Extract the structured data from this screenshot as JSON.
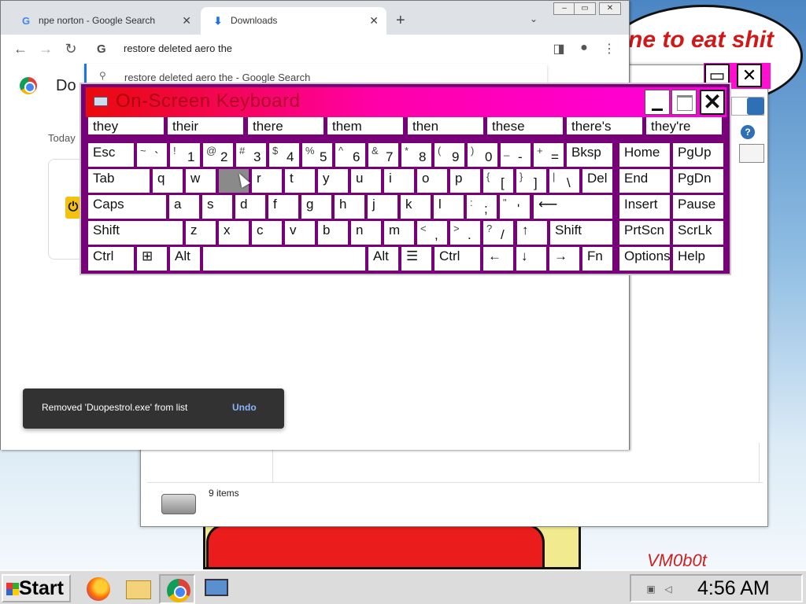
{
  "desktop": {
    "bubble_text": "ne to eat shit",
    "watermark": "VM0b0t"
  },
  "explorer": {
    "status_text": "9 items"
  },
  "chrome": {
    "tabs": [
      {
        "label": "npe norton - Google Search",
        "icon": "G"
      },
      {
        "label": "Downloads",
        "icon": "⬇"
      }
    ],
    "omnibox": {
      "value": "restore deleted aero the",
      "suggestion": "restore deleted aero the - Google Search"
    },
    "page_title": "Do",
    "today_label": "Today",
    "snackbar": {
      "text": "Removed 'Duopestrol.exe' from list",
      "action": "Undo"
    }
  },
  "osk": {
    "title": "On-Screen Keyboard",
    "predictions": [
      "they",
      "their",
      "there",
      "them",
      "then",
      "these",
      "there's",
      "they're"
    ],
    "rows": {
      "r1": [
        {
          "s": "",
          "m": "Esc"
        },
        {
          "s": "~",
          "m": "`"
        },
        {
          "s": "!",
          "m": "1"
        },
        {
          "s": "@",
          "m": "2"
        },
        {
          "s": "#",
          "m": "3"
        },
        {
          "s": "$",
          "m": "4"
        },
        {
          "s": "%",
          "m": "5"
        },
        {
          "s": "^",
          "m": "6"
        },
        {
          "s": "&",
          "m": "7"
        },
        {
          "s": "*",
          "m": "8"
        },
        {
          "s": "(",
          "m": "9"
        },
        {
          "s": ")",
          "m": "0"
        },
        {
          "s": "_",
          "m": "-"
        },
        {
          "s": "+",
          "m": "="
        },
        {
          "s": "",
          "m": "Bksp"
        },
        {
          "s": "",
          "m": "Home"
        },
        {
          "s": "",
          "m": "PgUp"
        }
      ],
      "r2": [
        {
          "s": "",
          "m": "Tab"
        },
        {
          "s": "",
          "m": "q"
        },
        {
          "s": "",
          "m": "w"
        },
        {
          "s": "",
          "m": ""
        },
        {
          "s": "",
          "m": "r"
        },
        {
          "s": "",
          "m": "t"
        },
        {
          "s": "",
          "m": "y"
        },
        {
          "s": "",
          "m": "u"
        },
        {
          "s": "",
          "m": "i"
        },
        {
          "s": "",
          "m": "o"
        },
        {
          "s": "",
          "m": "p"
        },
        {
          "s": "{",
          "m": "["
        },
        {
          "s": "}",
          "m": "]"
        },
        {
          "s": "|",
          "m": "\\"
        },
        {
          "s": "",
          "m": "Del"
        },
        {
          "s": "",
          "m": "End"
        },
        {
          "s": "",
          "m": "PgDn"
        }
      ],
      "r3": [
        {
          "s": "",
          "m": "Caps"
        },
        {
          "s": "",
          "m": "a"
        },
        {
          "s": "",
          "m": "s"
        },
        {
          "s": "",
          "m": "d"
        },
        {
          "s": "",
          "m": "f"
        },
        {
          "s": "",
          "m": "g"
        },
        {
          "s": "",
          "m": "h"
        },
        {
          "s": "",
          "m": "j"
        },
        {
          "s": "",
          "m": "k"
        },
        {
          "s": "",
          "m": "l"
        },
        {
          "s": ":",
          "m": ";"
        },
        {
          "s": "\"",
          "m": "'"
        },
        {
          "s": "",
          "m": "⟵"
        },
        {
          "s": "",
          "m": "Insert"
        },
        {
          "s": "",
          "m": "Pause"
        }
      ],
      "r4": [
        {
          "s": "",
          "m": "Shift"
        },
        {
          "s": "",
          "m": "z"
        },
        {
          "s": "",
          "m": "x"
        },
        {
          "s": "",
          "m": "c"
        },
        {
          "s": "",
          "m": "v"
        },
        {
          "s": "",
          "m": "b"
        },
        {
          "s": "",
          "m": "n"
        },
        {
          "s": "",
          "m": "m"
        },
        {
          "s": "<",
          "m": ","
        },
        {
          "s": ">",
          "m": "."
        },
        {
          "s": "?",
          "m": "/"
        },
        {
          "s": "",
          "m": "↑"
        },
        {
          "s": "",
          "m": "Shift"
        },
        {
          "s": "",
          "m": "PrtScn"
        },
        {
          "s": "",
          "m": "ScrLk"
        }
      ],
      "r5": [
        {
          "s": "",
          "m": "Ctrl"
        },
        {
          "s": "",
          "m": "⊞"
        },
        {
          "s": "",
          "m": "Alt"
        },
        {
          "s": "",
          "m": ""
        },
        {
          "s": "",
          "m": "Alt"
        },
        {
          "s": "",
          "m": "☰"
        },
        {
          "s": "",
          "m": "Ctrl"
        },
        {
          "s": "",
          "m": "←"
        },
        {
          "s": "",
          "m": "↓"
        },
        {
          "s": "",
          "m": "→"
        },
        {
          "s": "",
          "m": "Fn"
        },
        {
          "s": "",
          "m": "Options"
        },
        {
          "s": "",
          "m": "Help"
        }
      ]
    },
    "pressed_key": "e"
  },
  "taskbar": {
    "start_label": "Start",
    "clock": "4:56 AM"
  }
}
